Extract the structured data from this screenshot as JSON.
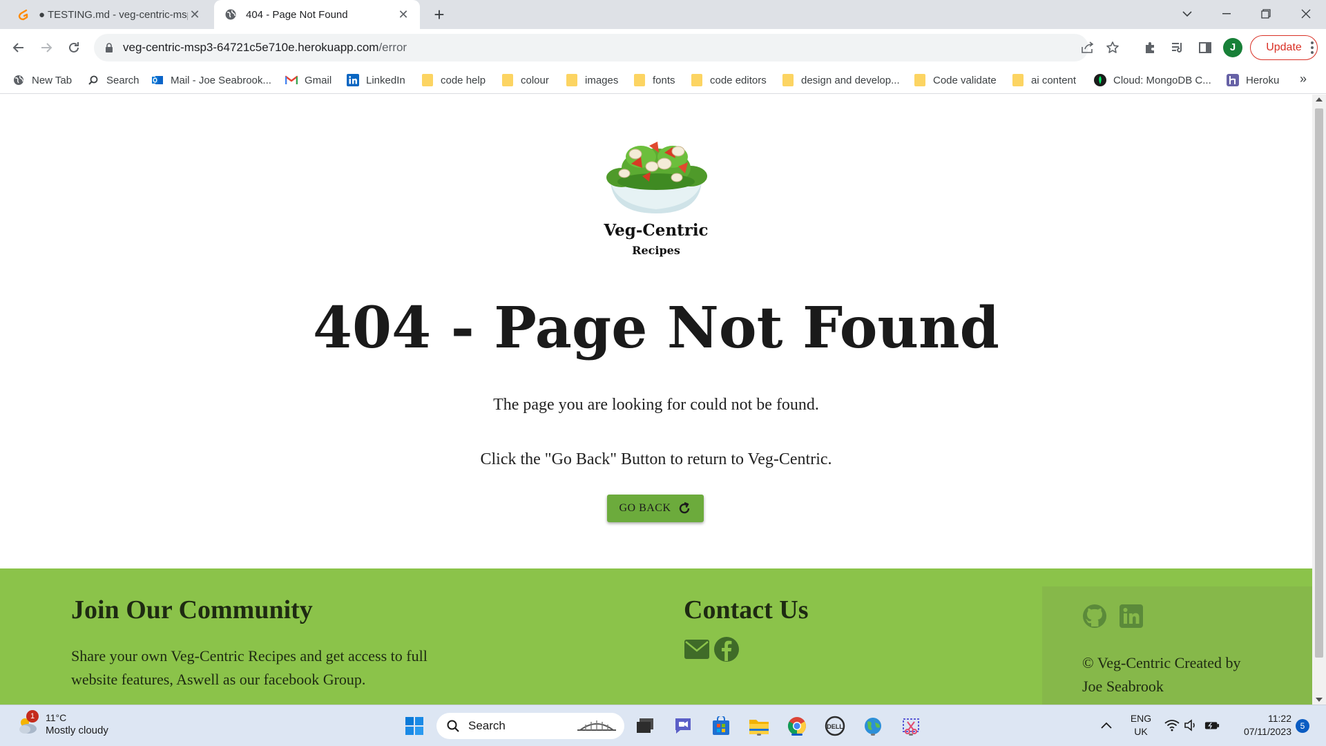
{
  "browser": {
    "tabs": [
      {
        "title": "● TESTING.md - veg-centric-msp3",
        "active": false
      },
      {
        "title": "404 - Page Not Found",
        "active": true
      }
    ],
    "url_host": "veg-centric-msp3-64721c5e710e.herokuapp.com",
    "url_path": "/error",
    "profile_initial": "J",
    "update_label": "Update",
    "bookmarks": [
      {
        "label": "New Tab",
        "icon": "globe-icon"
      },
      {
        "label": "Search",
        "icon": "search-icon"
      },
      {
        "label": "Mail - Joe Seabrook...",
        "icon": "outlook-icon"
      },
      {
        "label": "Gmail",
        "icon": "gmail-icon"
      },
      {
        "label": "LinkedIn",
        "icon": "linkedin-icon"
      },
      {
        "label": "code help",
        "icon": "folder-icon"
      },
      {
        "label": "colour",
        "icon": "folder-icon"
      },
      {
        "label": "images",
        "icon": "folder-icon"
      },
      {
        "label": "fonts",
        "icon": "folder-icon"
      },
      {
        "label": "code editors",
        "icon": "folder-icon"
      },
      {
        "label": "design and develop...",
        "icon": "folder-icon"
      },
      {
        "label": "Code validate",
        "icon": "folder-icon"
      },
      {
        "label": "ai content",
        "icon": "folder-icon"
      },
      {
        "label": "Cloud: MongoDB C...",
        "icon": "mongodb-icon"
      },
      {
        "label": "Heroku",
        "icon": "heroku-icon"
      }
    ],
    "more_bookmarks": "»"
  },
  "page": {
    "logo_title": "Veg-Centric",
    "logo_subtitle": "Recipes",
    "error_title": "404 - Page Not Found",
    "message_1": "The page you are looking for could not be found.",
    "message_2": "Click the \"Go Back\" Button to return to Veg-Centric.",
    "go_back_label": "GO BACK",
    "accent_color": "#8bc34a",
    "button_color": "#6cab3c"
  },
  "footer": {
    "community_heading": "Join Our Community",
    "community_line_1": "Share your own Veg-Centric Recipes and get access to full",
    "community_line_2": "website features, Aswell as our facebook Group.",
    "contact_heading": "Contact Us",
    "contact_icons": [
      "envelope-icon",
      "facebook-icon"
    ],
    "social_icons": [
      "github-icon",
      "linkedin-icon"
    ],
    "copyright_line_1": "© Veg-Centric Created by",
    "copyright_line_2": "Joe Seabrook"
  },
  "taskbar": {
    "weather_badge": "1",
    "temperature": "11°C",
    "condition": "Mostly cloudy",
    "search_label": "Search",
    "lang_1": "ENG",
    "lang_2": "UK",
    "time": "11:22",
    "date": "07/11/2023",
    "notifications": "5"
  }
}
